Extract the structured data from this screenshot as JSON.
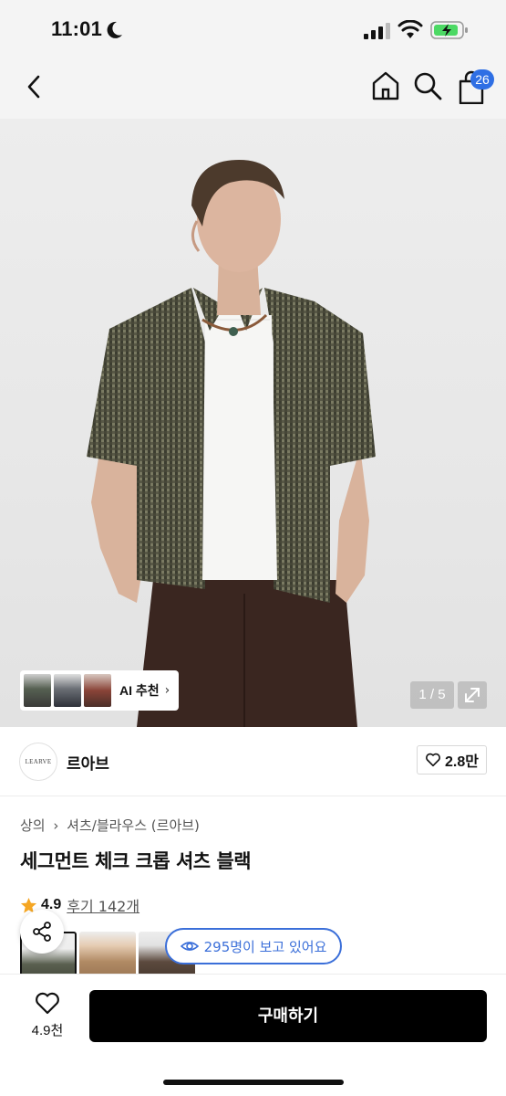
{
  "status": {
    "time": "11:01"
  },
  "nav": {
    "cart_count": "26",
    "icons": [
      "back-icon",
      "home-icon",
      "search-icon",
      "shopping-bag-icon"
    ]
  },
  "hero": {
    "ai_recommend_label": "AI 추천",
    "page_indicator": "1 / 5"
  },
  "brand": {
    "logo_text": "LEARVE",
    "name": "르아브",
    "likes": "2.8만"
  },
  "product": {
    "breadcrumb": [
      "상의",
      "셔츠/블라우스 (르아브)"
    ],
    "title": "세그먼트 체크 크롭 셔츠 블랙",
    "rating": "4.9",
    "reviews": "후기 142개",
    "viewers": "295명이 보고 있어요"
  },
  "bottom": {
    "wish_count": "4.9천",
    "buy_label": "구매하기"
  },
  "colors": {
    "accent": "#2f6fe4",
    "primary_button": "#000000",
    "star": "#f5a623"
  }
}
